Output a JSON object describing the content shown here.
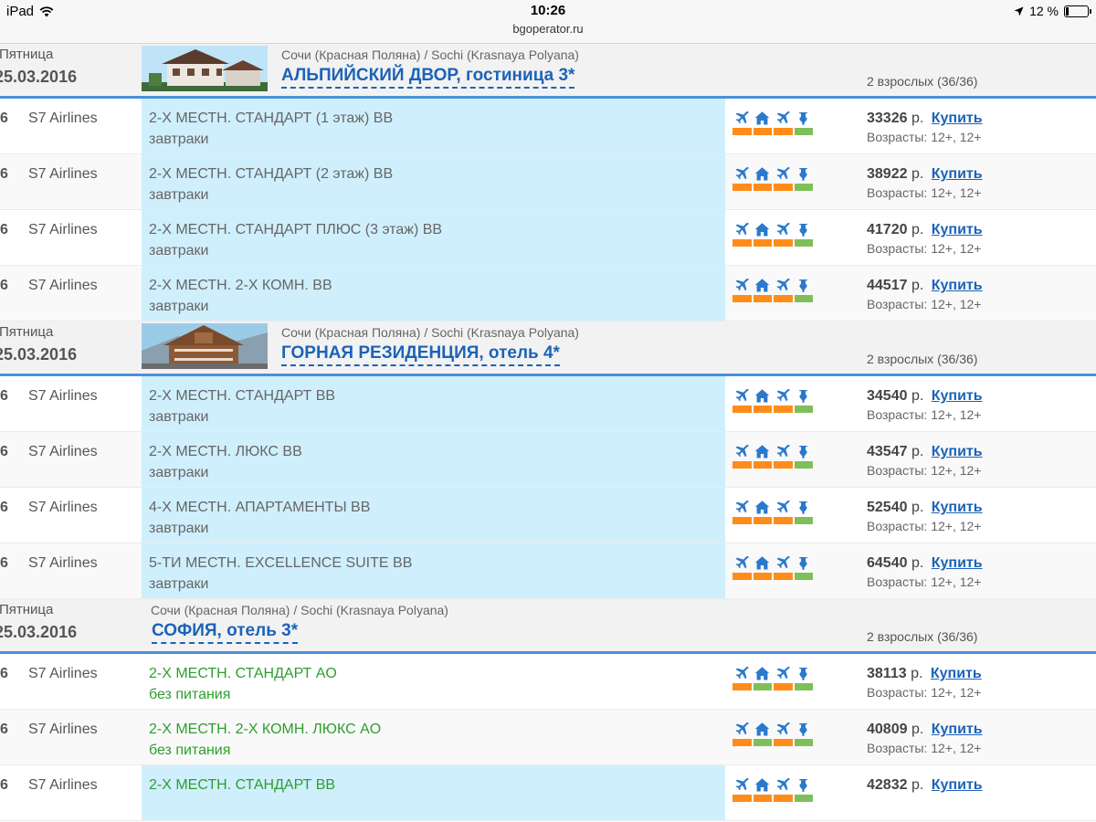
{
  "status_bar": {
    "device": "iPad",
    "time": "10:26",
    "url": "bgoperator.ru",
    "battery": "12 %",
    "battery_level": 0.12
  },
  "buy_label": "Купить",
  "currency": "р.",
  "colors": {
    "accent_blue": "#1b63b8",
    "divider_blue": "#4a90d8",
    "room_bg": "#cfeffd",
    "bar_orange": "#ff8c1a",
    "bar_green": "#7fbf5a",
    "meal_green": "#2e9e2e"
  },
  "icon_names": [
    "plane-icon",
    "house-icon",
    "plane-icon",
    "medical-icon"
  ],
  "hotels": [
    {
      "day": "Пятница",
      "date": "25.03.2016",
      "photo": "hotel-photo-alpine",
      "location": "Сочи (Красная Поляна) / Sochi (Krasnaya Polyana)",
      "name": "АЛЬПИЙСКИЙ ДВОР, гостиница 3*",
      "guests": "2 взрослых (36/36)",
      "offers": [
        {
          "num": "6",
          "airline": "S7 Airlines",
          "room": "2-Х МЕСТН. СТАНДАРТ (1 этаж) BB",
          "meal": "завтраки",
          "bars": [
            "orange",
            "orange",
            "orange",
            "green"
          ],
          "price": "33326",
          "ages": "Возрасты: 12+, 12+"
        },
        {
          "num": "6",
          "airline": "S7 Airlines",
          "room": "2-Х МЕСТН. СТАНДАРТ (2 этаж) BB",
          "meal": "завтраки",
          "bars": [
            "orange",
            "orange",
            "orange",
            "green"
          ],
          "price": "38922",
          "ages": "Возрасты: 12+, 12+"
        },
        {
          "num": "6",
          "airline": "S7 Airlines",
          "room": "2-Х МЕСТН. СТАНДАРТ ПЛЮС (3 этаж) BB",
          "meal": "завтраки",
          "bars": [
            "orange",
            "orange",
            "orange",
            "green"
          ],
          "price": "41720",
          "ages": "Возрасты: 12+, 12+"
        },
        {
          "num": "6",
          "airline": "S7 Airlines",
          "room": "2-Х МЕСТН. 2-Х КОМН. BB",
          "meal": "завтраки",
          "bars": [
            "orange",
            "orange",
            "orange",
            "green"
          ],
          "price": "44517",
          "ages": "Возрасты: 12+, 12+"
        }
      ]
    },
    {
      "day": "Пятница",
      "date": "25.03.2016",
      "photo": "hotel-photo-mountain",
      "location": "Сочи (Красная Поляна) / Sochi (Krasnaya Polyana)",
      "name": "ГОРНАЯ РЕЗИДЕНЦИЯ, отель 4*",
      "guests": "2 взрослых (36/36)",
      "offers": [
        {
          "num": "6",
          "airline": "S7 Airlines",
          "room": "2-Х МЕСТН. СТАНДАРТ BB",
          "meal": "завтраки",
          "bars": [
            "orange",
            "orange",
            "orange",
            "green"
          ],
          "price": "34540",
          "ages": "Возрасты: 12+, 12+"
        },
        {
          "num": "6",
          "airline": "S7 Airlines",
          "room": "2-Х МЕСТН. ЛЮКС BB",
          "meal": "завтраки",
          "bars": [
            "orange",
            "orange",
            "orange",
            "green"
          ],
          "price": "43547",
          "ages": "Возрасты: 12+, 12+"
        },
        {
          "num": "6",
          "airline": "S7 Airlines",
          "room": "4-Х МЕСТН. АПАРТАМЕНТЫ BB",
          "meal": "завтраки",
          "bars": [
            "orange",
            "orange",
            "orange",
            "green"
          ],
          "price": "52540",
          "ages": "Возрасты: 12+, 12+"
        },
        {
          "num": "6",
          "airline": "S7 Airlines",
          "room": "5-ТИ МЕСТН. EXCELLENCE SUITE BB",
          "meal": "завтраки",
          "bars": [
            "orange",
            "orange",
            "orange",
            "green"
          ],
          "price": "64540",
          "ages": "Возрасты: 12+, 12+"
        }
      ]
    },
    {
      "day": "Пятница",
      "date": "25.03.2016",
      "photo": "",
      "location": "Сочи (Красная Поляна) / Sochi (Krasnaya Polyana)",
      "name": "СОФИЯ, отель 3*",
      "guests": "2 взрослых (36/36)",
      "offers": [
        {
          "num": "6",
          "airline": "S7 Airlines",
          "room": "2-Х МЕСТН. СТАНДАРТ AO",
          "meal": "без питания",
          "bars": [
            "orange",
            "green",
            "orange",
            "green"
          ],
          "price": "38113",
          "ages": "Возрасты: 12+, 12+",
          "green": true
        },
        {
          "num": "6",
          "airline": "S7 Airlines",
          "room": "2-Х МЕСТН. 2-Х КОМН. ЛЮКС AO",
          "meal": "без питания",
          "bars": [
            "orange",
            "green",
            "orange",
            "green"
          ],
          "price": "40809",
          "ages": "Возрасты: 12+, 12+",
          "green": true
        },
        {
          "num": "6",
          "airline": "S7 Airlines",
          "room": "2-Х МЕСТН. СТАНДАРТ BB",
          "meal": "",
          "bars": [
            "orange",
            "orange",
            "orange",
            "green"
          ],
          "price": "42832",
          "ages": "",
          "green": true,
          "blue_bg": true
        }
      ]
    }
  ]
}
